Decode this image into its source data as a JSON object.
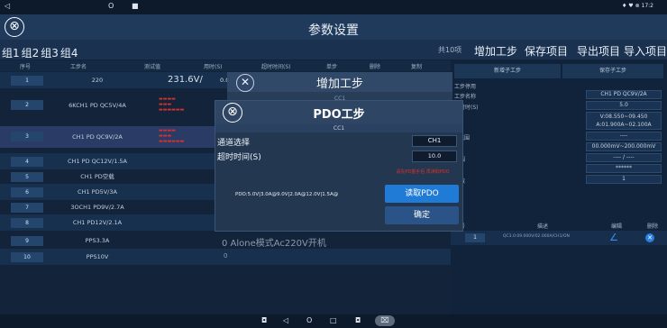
{
  "status": {
    "back_glyph": "◁",
    "home_glyph": "O",
    "small_square_glyph": "■",
    "right_icons": "♦ ♥ ⊗ 17:2"
  },
  "header": {
    "title": "参数设置",
    "close_glyph": "⊗"
  },
  "tabs": [
    "组1",
    "组2",
    "组3",
    "组4"
  ],
  "toolbar": {
    "count_text": "共10项",
    "add_step": "增加工步",
    "save_item": "保存项目",
    "export_item": "导出项目",
    "import_item": "导入项目"
  },
  "table": {
    "headers": [
      "序号",
      "工步名",
      "测试值",
      "用时(S)",
      "超时时间(S)",
      "单步",
      "删除",
      "复制"
    ],
    "rows": [
      {
        "no": "1",
        "name": "220",
        "value": "231.6V/",
        "extra": "0.0"
      },
      {
        "no": "2",
        "name": "6KCH1 PD QC5V/4A",
        "value": "",
        "extra": ""
      },
      {
        "no": "3",
        "name": "CH1 PD QC9V/2A",
        "value": "",
        "extra": ""
      },
      {
        "no": "4",
        "name": "CH1 PD QC12V/1.5A",
        "value": "",
        "extra": ""
      },
      {
        "no": "5",
        "name": "CH1 PD空载",
        "value": "",
        "extra": ""
      },
      {
        "no": "6",
        "name": "CH1 PD5V/3A",
        "value": "",
        "extra": ""
      },
      {
        "no": "7",
        "name": "3OCH1 PD9V/2.7A",
        "value": "",
        "extra": ""
      },
      {
        "no": "8",
        "name": "CH1 PD12V/2.1A",
        "value": "",
        "extra": ""
      },
      {
        "no": "9",
        "name": "PPS3.3A",
        "value": "",
        "extra": ""
      },
      {
        "no": "10",
        "name": "PPS10V",
        "value": "",
        "extra": ""
      }
    ],
    "row9_extra": "0 Alone模式Ac220V开机",
    "row10_extra": "0"
  },
  "right_panel": {
    "add_child": "新增子工步",
    "save_child": "保存子工步",
    "labels": [
      "工步停用",
      "工步名称",
      "超时时(S)",
      "",
      "范围",
      "",
      "范围",
      "",
      "次数"
    ],
    "step_name": "CH1 PD QC9V/2A",
    "timeout": "5.0",
    "range1": "V:08.550~09.450\nA:01.900A~02.100A",
    "range2": "----",
    "range3": "00.000mV~200.000mV",
    "range4": "---- / ----",
    "password": "******",
    "count": "1",
    "list_headers": {
      "no": "序号",
      "desc": "描述",
      "edit": "编辑",
      "delete": "删除"
    },
    "list_row": {
      "no": "1",
      "desc": "QC3.0:09.000V/02.000A/CH1/ON"
    }
  },
  "bg_dialog": {
    "title": "增加工步",
    "sub": "CC1"
  },
  "dialog": {
    "title": "PDO工步",
    "close_glyph": "⊗",
    "cc_label": "CC1",
    "channel_label": "通道选择",
    "channel_value": "CH1",
    "timeout_label": "超时时间(S)",
    "timeout_value": "10.0",
    "warn_text": "请先PD握手后 再读取PDO",
    "pdo_text": "PDO:5.0V|3.0A@9.0V|2.0A@12.0V|1.5A@",
    "read_button": "读取PDO",
    "ok_button": "确定"
  },
  "navbar": {
    "items": [
      "◘",
      "◁",
      "O",
      "□",
      "◘",
      "⌧"
    ]
  }
}
